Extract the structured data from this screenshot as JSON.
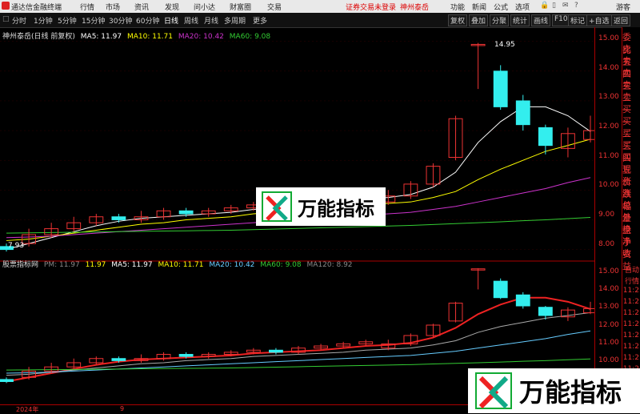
{
  "titlebar": {
    "app_title": "通达信金融终端",
    "menus": [
      "行情",
      "市场",
      "资讯",
      "发现",
      "问小达",
      "财富圈",
      "交易"
    ],
    "notice": "证券交易未登录",
    "stock": "神州泰岳",
    "right_menus": [
      "功能",
      "新闻",
      "公式",
      "选项"
    ],
    "guest": "游客"
  },
  "toolbar": {
    "periods": [
      "分时",
      "1分钟",
      "5分钟",
      "15分钟",
      "30分钟",
      "60分钟",
      "日线",
      "周线",
      "月线",
      "多周期",
      "更多"
    ],
    "active_period": "日线",
    "right_buttons": [
      "复权",
      "叠加",
      "分聚",
      "统计",
      "画线",
      "F10",
      "标记",
      "+自选",
      "返回"
    ]
  },
  "main_legend": {
    "name": "神州泰岳(日线 前复权)",
    "ma5": "MA5: 11.97",
    "ma10": "MA10: 11.71",
    "ma20": "MA20: 10.42",
    "ma60": "MA60: 9.08"
  },
  "sub_legend": {
    "name": "股票指标网",
    "pm": "PM: 11.97",
    "pm_val": "11.97",
    "ma5": "MA5: 11.97",
    "ma10": "MA10: 11.71",
    "ma20": "MA20: 10.42",
    "ma60": "MA60: 9.08",
    "ma120": "MA120: 8.92"
  },
  "main_axis": [
    "15.00",
    "14.00",
    "13.00",
    "12.00",
    "11.00",
    "10.00",
    "9.00",
    "8.00"
  ],
  "sub_axis": [
    "15.00",
    "14.00",
    "13.00",
    "12.00",
    "11.00",
    "10.00"
  ],
  "main_price_tags": {
    "high": "14.95",
    "low": "7.93"
  },
  "quote_labels": [
    "委比",
    "卖五",
    "卖四",
    "卖三",
    "卖二",
    "卖一",
    "买一",
    "买二",
    "买三",
    "买四",
    "买五",
    "现价",
    "涨跌",
    "涨幅",
    "总量",
    "外盘",
    "换手",
    "净资",
    "收益"
  ],
  "quote_labels2": [
    "自动",
    "行情",
    "11:2",
    "11:2",
    "11:2",
    "11:2",
    "11:2",
    "11:2",
    "11:2",
    "11:2",
    "11:2",
    "11:2",
    "11:2"
  ],
  "bottom_axis": {
    "year": "2024年",
    "month": "9"
  },
  "watermark": "万能指标",
  "colors": {
    "up": "#e33",
    "down": "#3ee",
    "ma5": "#fff",
    "ma10": "#ff0",
    "ma20": "#c3c",
    "ma60": "#3c3"
  },
  "chart_data": {
    "type": "line",
    "title": "神州泰岳(日线 前复权)",
    "ylim": [
      7.5,
      15.3
    ],
    "candles": [
      {
        "o": 8.1,
        "c": 8.0,
        "h": 8.2,
        "l": 7.93
      },
      {
        "o": 8.2,
        "c": 8.5,
        "h": 8.7,
        "l": 8.1
      },
      {
        "o": 8.5,
        "c": 8.7,
        "h": 8.9,
        "l": 8.4
      },
      {
        "o": 8.7,
        "c": 8.9,
        "h": 9.1,
        "l": 8.6
      },
      {
        "o": 8.9,
        "c": 9.1,
        "h": 9.2,
        "l": 8.8
      },
      {
        "o": 9.1,
        "c": 9.0,
        "h": 9.2,
        "l": 8.9
      },
      {
        "o": 9.0,
        "c": 9.1,
        "h": 9.3,
        "l": 8.9
      },
      {
        "o": 9.1,
        "c": 9.3,
        "h": 9.4,
        "l": 9.0
      },
      {
        "o": 9.3,
        "c": 9.2,
        "h": 9.4,
        "l": 9.1
      },
      {
        "o": 9.2,
        "c": 9.3,
        "h": 9.4,
        "l": 9.1
      },
      {
        "o": 9.3,
        "c": 9.4,
        "h": 9.5,
        "l": 9.2
      },
      {
        "o": 9.4,
        "c": 9.5,
        "h": 9.6,
        "l": 9.3
      },
      {
        "o": 9.5,
        "c": 9.4,
        "h": 9.6,
        "l": 9.3
      },
      {
        "o": 9.4,
        "c": 9.6,
        "h": 9.7,
        "l": 9.3
      },
      {
        "o": 9.6,
        "c": 9.7,
        "h": 9.8,
        "l": 9.5
      },
      {
        "o": 9.7,
        "c": 9.8,
        "h": 9.9,
        "l": 9.6
      },
      {
        "o": 9.8,
        "c": 9.9,
        "h": 10.0,
        "l": 9.7
      },
      {
        "o": 9.6,
        "c": 9.8,
        "h": 10.0,
        "l": 9.5
      },
      {
        "o": 9.8,
        "c": 10.2,
        "h": 10.3,
        "l": 9.7
      },
      {
        "o": 10.2,
        "c": 10.8,
        "h": 10.9,
        "l": 10.1
      },
      {
        "o": 11.1,
        "c": 12.4,
        "h": 12.5,
        "l": 11.0
      },
      {
        "o": 14.9,
        "c": 14.9,
        "h": 14.95,
        "l": 13.4
      },
      {
        "o": 14.0,
        "c": 12.8,
        "h": 14.2,
        "l": 12.7
      },
      {
        "o": 13.0,
        "c": 12.2,
        "h": 13.2,
        "l": 12.0
      },
      {
        "o": 12.1,
        "c": 11.5,
        "h": 12.2,
        "l": 11.2
      },
      {
        "o": 11.4,
        "c": 11.9,
        "h": 12.1,
        "l": 11.1
      },
      {
        "o": 11.7,
        "c": 12.0,
        "h": 12.5,
        "l": 11.6
      }
    ],
    "series": [
      {
        "name": "MA5",
        "values": [
          8.0,
          8.2,
          8.4,
          8.6,
          8.8,
          8.95,
          9.05,
          9.1,
          9.15,
          9.2,
          9.25,
          9.35,
          9.4,
          9.45,
          9.5,
          9.6,
          9.7,
          9.75,
          9.85,
          10.1,
          10.6,
          11.6,
          12.3,
          12.8,
          12.8,
          12.5,
          11.97
        ]
      },
      {
        "name": "MA10",
        "values": [
          8.3,
          8.35,
          8.45,
          8.55,
          8.65,
          8.75,
          8.85,
          8.9,
          9.0,
          9.05,
          9.1,
          9.2,
          9.25,
          9.3,
          9.35,
          9.4,
          9.5,
          9.55,
          9.6,
          9.75,
          9.95,
          10.35,
          10.7,
          11.0,
          11.3,
          11.5,
          11.71
        ]
      },
      {
        "name": "MA20",
        "values": [
          8.4,
          8.42,
          8.45,
          8.5,
          8.55,
          8.6,
          8.65,
          8.7,
          8.75,
          8.8,
          8.85,
          8.9,
          8.95,
          9.0,
          9.05,
          9.1,
          9.15,
          9.2,
          9.25,
          9.35,
          9.45,
          9.6,
          9.75,
          9.9,
          10.05,
          10.25,
          10.42
        ]
      },
      {
        "name": "MA60",
        "values": [
          8.55,
          8.56,
          8.57,
          8.58,
          8.59,
          8.6,
          8.61,
          8.62,
          8.63,
          8.64,
          8.65,
          8.67,
          8.69,
          8.71,
          8.73,
          8.75,
          8.77,
          8.79,
          8.81,
          8.84,
          8.87,
          8.9,
          8.93,
          8.97,
          9.0,
          9.04,
          9.08
        ]
      }
    ]
  }
}
